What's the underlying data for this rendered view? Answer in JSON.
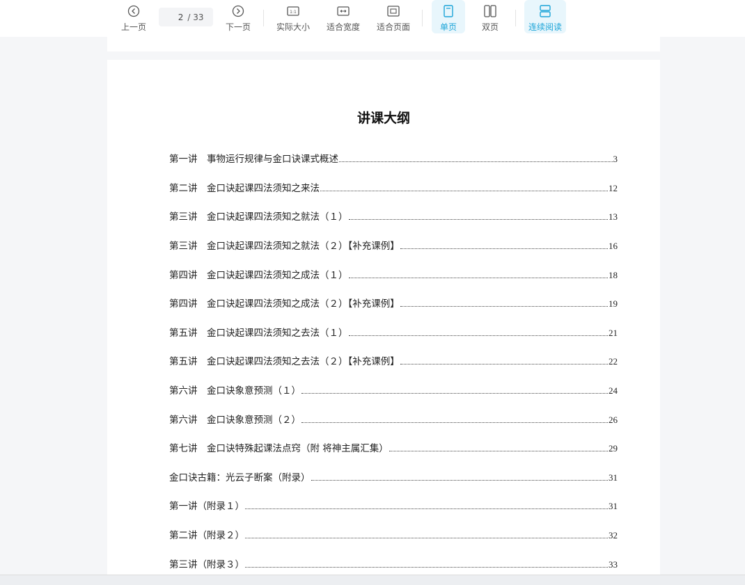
{
  "toolbar": {
    "prev_label": "上一页",
    "current_page": "2",
    "total_pages": "/ 33",
    "next_label": "下一页",
    "actual_size_label": "实际大小",
    "fit_width_label": "适合宽度",
    "fit_page_label": "适合页面",
    "single_page_label": "单页",
    "double_page_label": "双页",
    "continuous_label": "连续阅读",
    "accent_color": "#1ba4d8"
  },
  "document": {
    "title": "讲课大纲",
    "toc": [
      {
        "label": "第一讲　事物运行规律与金口诀课式概述",
        "page": "3"
      },
      {
        "label": "第二讲　金口诀起课四法须知之来法",
        "page": "12"
      },
      {
        "label": "第三讲　金口诀起课四法须知之就法（１）",
        "page": "13"
      },
      {
        "label": "第三讲　金口诀起课四法须知之就法（２）【补充课例】",
        "page": "16"
      },
      {
        "label": "第四讲　金口诀起课四法须知之成法（１）",
        "page": "18"
      },
      {
        "label": "第四讲　金口诀起课四法须知之成法（２）【补充课例】",
        "page": "19"
      },
      {
        "label": "第五讲　金口诀起课四法须知之去法（１）",
        "page": "21"
      },
      {
        "label": "第五讲　金口诀起课四法须知之去法（２）【补充课例】",
        "page": "22"
      },
      {
        "label": "第六讲　金口诀象意预测（１）",
        "page": "24"
      },
      {
        "label": "第六讲　金口诀象意预测（２）",
        "page": "26"
      },
      {
        "label": "第七讲　金口诀特殊起课法点窍（附 将神主属汇集）",
        "page": "29"
      },
      {
        "label": "金口诀古籍：光云子断案（附录）",
        "page": "31"
      },
      {
        "label": "第一讲（附录１）",
        "page": "31"
      },
      {
        "label": "第二讲（附录２）",
        "page": "32"
      },
      {
        "label": "第三讲（附录３）",
        "page": "33"
      }
    ]
  }
}
